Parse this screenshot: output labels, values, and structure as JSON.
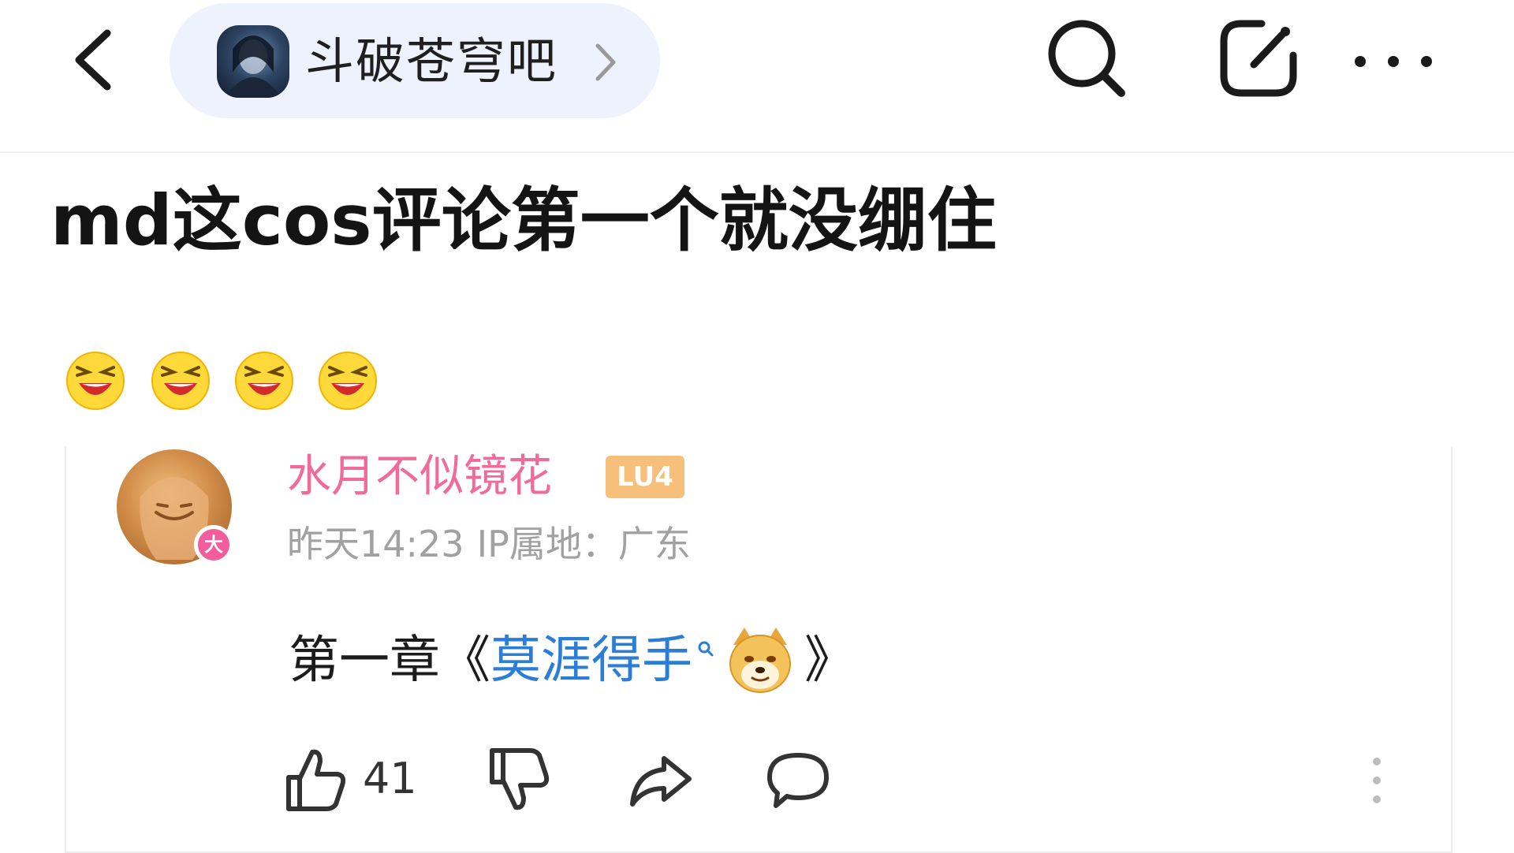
{
  "header": {
    "back_icon": "chevron-left-icon",
    "forum_name": "斗破苍穹吧",
    "forum_chevron_icon": "chevron-right-icon",
    "search_icon": "search-icon",
    "share_icon": "share-icon",
    "more_icon": "more-horizontal-icon"
  },
  "post": {
    "title": "md这cos评论第一个就没绷住",
    "emojis": [
      "laughing-face-emoji",
      "laughing-face-emoji",
      "laughing-face-emoji",
      "laughing-face-emoji"
    ]
  },
  "quoted_comment": {
    "username": "水月不似镜花",
    "level_label": "LU4",
    "avatar_badge_text": "大",
    "time": "昨天14:23",
    "ip_location": "IP属地：广东",
    "text_prefix": "第一章《",
    "link_text": "莫涯得手",
    "text_suffix": "》",
    "like_count": "41",
    "emoji_icon": "doge-emoji"
  },
  "colors": {
    "accent_pink": "#f06b9a",
    "link_blue": "#2b7dd6",
    "pill_bg": "#eef2fd",
    "meta_gray": "#a1a1a1",
    "level_orange": "#f6c07a"
  }
}
